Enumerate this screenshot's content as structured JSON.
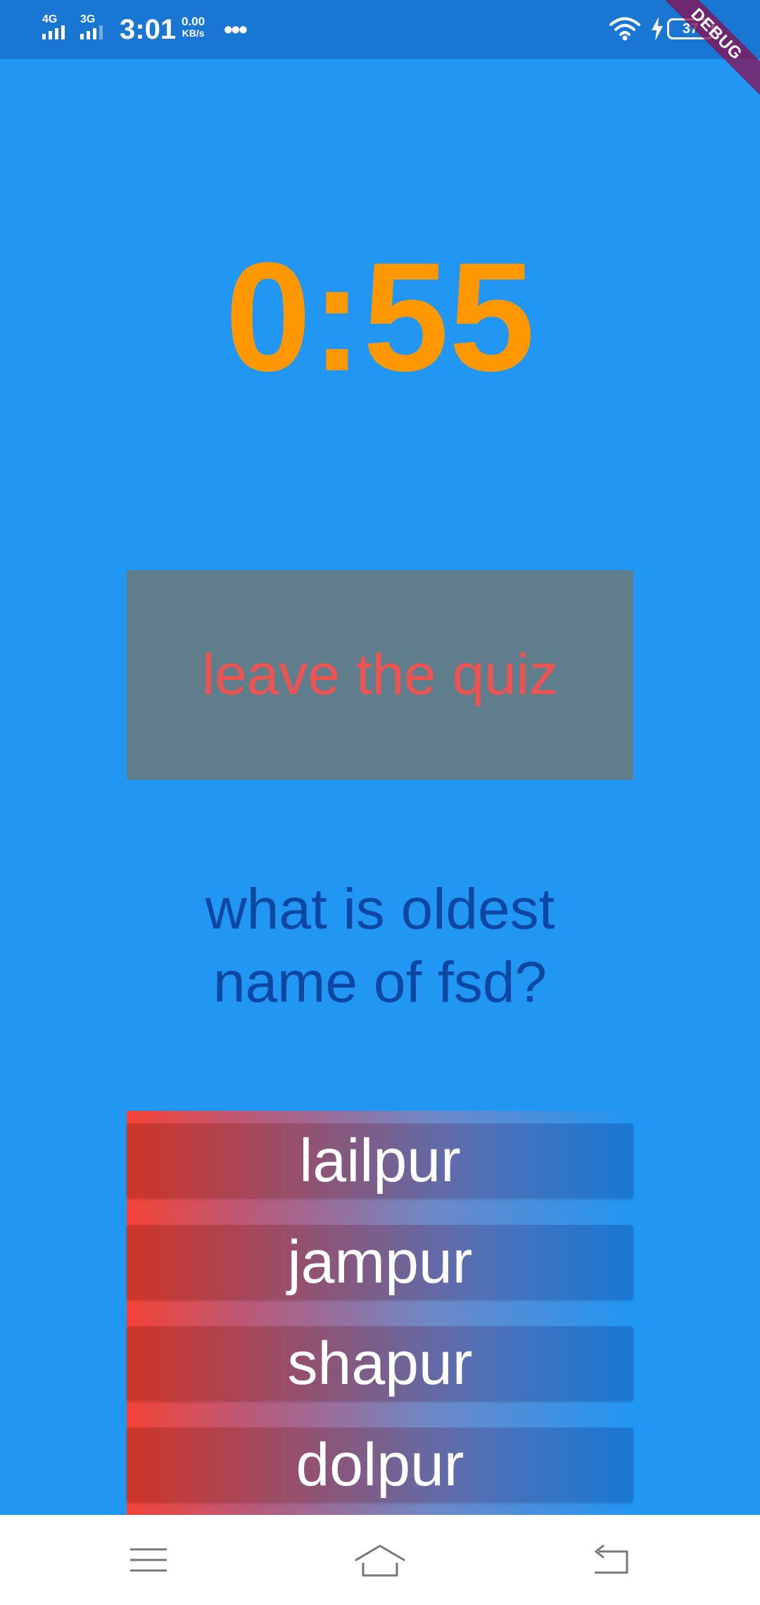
{
  "status_bar": {
    "network_1": "4G",
    "network_2": "3G",
    "time": "3:01",
    "speed_value": "0.00",
    "speed_unit": "KB/s",
    "more": "•••",
    "battery": "37",
    "debug": "DEBUG"
  },
  "quiz": {
    "timer": "0:55",
    "leave_label": "leave the quiz",
    "question": "what is oldest name of fsd?",
    "options": [
      "lailpur",
      "jampur",
      "shapur",
      "dolpur"
    ]
  },
  "nav": {
    "menu_icon": "menu-icon",
    "home_icon": "home-icon",
    "back_icon": "back-icon"
  },
  "colors": {
    "background": "#2196F3",
    "status_bar": "#1976D2",
    "timer": "#FF9800",
    "leave_button": "#607D8B",
    "leave_text": "#EF5350",
    "question_text": "#0D47A1"
  }
}
